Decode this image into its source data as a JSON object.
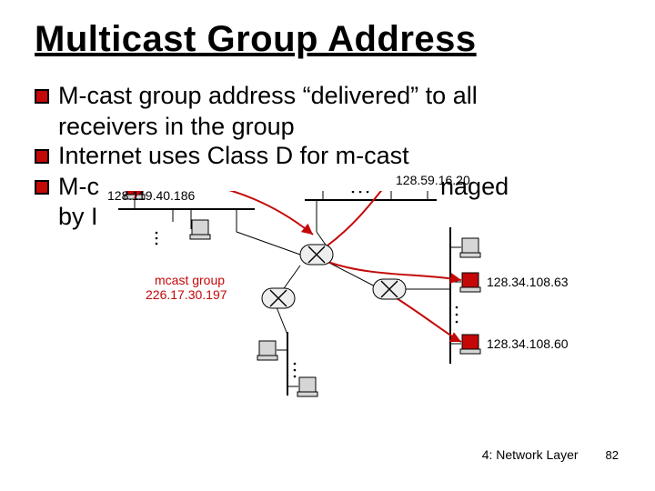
{
  "title": "Multicast Group Address",
  "bullets": [
    {
      "line1": "M-cast group address “delivered” to all",
      "cont": "receivers in the group"
    },
    {
      "line1": "Internet uses Class D for m-cast"
    },
    {
      "line1_pre": "M-c",
      "line1_post": "naged",
      "cont": "by I"
    }
  ],
  "diagram": {
    "hosts": {
      "top_left_ip": "128.119.40.186",
      "top_right_ip": "128.59.16.20",
      "right_mid_ip": "128.34.108.63",
      "right_bot_ip": "128.34.108.60"
    },
    "mcast_label_line1": "mcast group",
    "mcast_label_line2": "226.17.30.197"
  },
  "footer": {
    "section": "4: Network Layer",
    "page": "82"
  }
}
